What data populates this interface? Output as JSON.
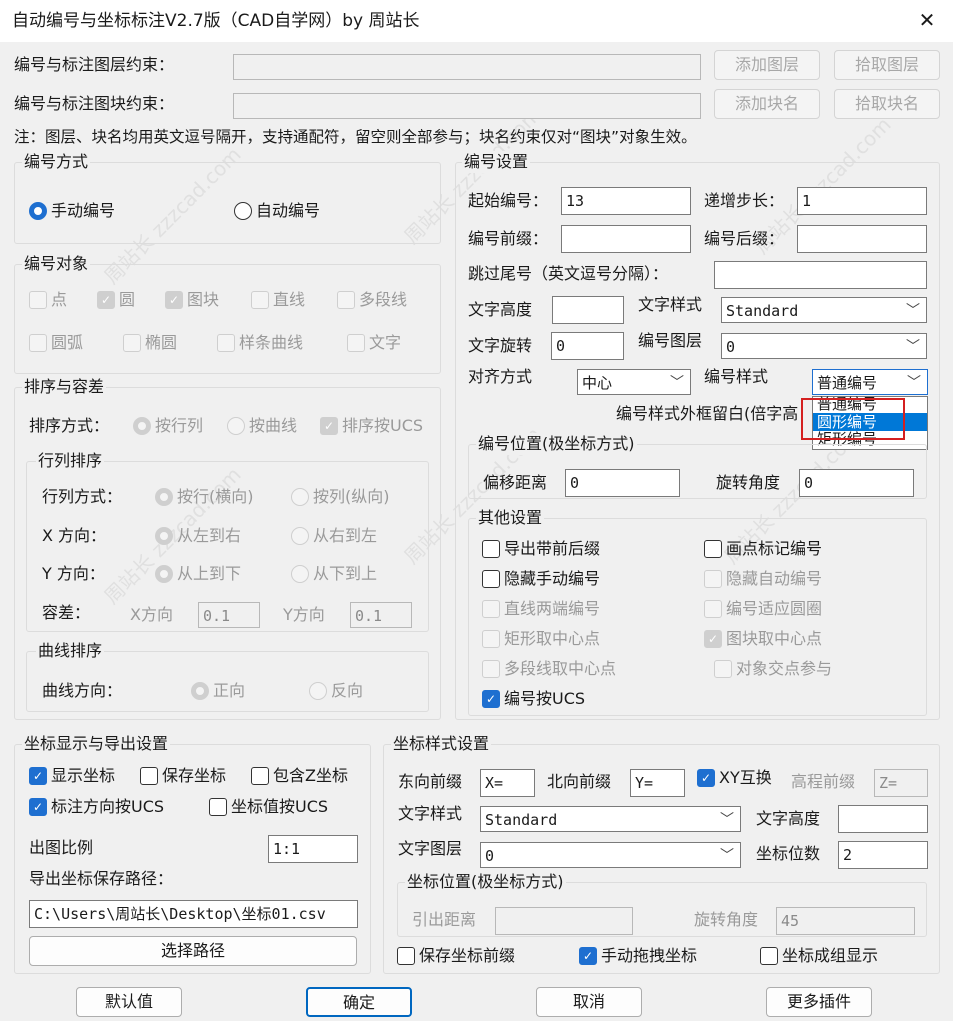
{
  "window": {
    "title": "自动编号与坐标标注V2.7版（CAD自学网）by 周站长",
    "close": "✕"
  },
  "top": {
    "layer_label": "编号与标注图层约束：",
    "block_label": "编号与标注图块约束：",
    "layer_value": "",
    "block_value": "",
    "add_layer": "添加图层",
    "pick_layer": "拾取图层",
    "add_block": "添加块名",
    "pick_block": "拾取块名",
    "note": "注：图层、块名均用英文逗号隔开，支持通配符，留空则全部参与；块名约束仅对“图块”对象生效。"
  },
  "numbering_mode": {
    "title": "编号方式",
    "manual": "手动编号",
    "auto": "自动编号",
    "selected": "手动编号"
  },
  "numbering_objects": {
    "title": "编号对象",
    "items": [
      {
        "label": "点",
        "checked": false
      },
      {
        "label": "圆",
        "checked": true
      },
      {
        "label": "图块",
        "checked": true
      },
      {
        "label": "直线",
        "checked": false
      },
      {
        "label": "多段线",
        "checked": false
      },
      {
        "label": "圆弧",
        "checked": false
      },
      {
        "label": "椭圆",
        "checked": false
      },
      {
        "label": "样条曲线",
        "checked": false
      },
      {
        "label": "文字",
        "checked": false
      }
    ]
  },
  "sort": {
    "title": "排序与容差",
    "mode_label": "排序方式：",
    "by_row": "按行列",
    "by_curve": "按曲线",
    "by_ucs": "排序按UCS",
    "row_col": {
      "title": "行列排序",
      "mode_label": "行列方式：",
      "row": "按行(横向)",
      "col": "按列(纵向)",
      "x_label": "X 方向：",
      "x_lr": "从左到右",
      "x_rl": "从右到左",
      "y_label": "Y 方向：",
      "y_tb": "从上到下",
      "y_bt": "从下到上",
      "tol_label": "容差：",
      "tol_x_label": "X方向",
      "tol_x": "0.1",
      "tol_y_label": "Y方向",
      "tol_y": "0.1"
    },
    "curve": {
      "title": "曲线排序",
      "dir_label": "曲线方向：",
      "forward": "正向",
      "reverse": "反向"
    }
  },
  "settings": {
    "title": "编号设置",
    "start_label": "起始编号：",
    "start": "13",
    "step_label": "递增步长：",
    "step": "1",
    "prefix_label": "编号前缀：",
    "prefix": "",
    "suffix_label": "编号后缀：",
    "suffix": "",
    "skip_label": "跳过尾号（英文逗号分隔）：",
    "skip": "",
    "text_height_label": "文字高度",
    "text_height": "",
    "text_style_label": "文字样式",
    "text_style": "Standard",
    "text_rot_label": "文字旋转",
    "text_rot": "0",
    "layer_label": "编号图层",
    "layer": "0",
    "align_label": "对齐方式",
    "align": "中心",
    "style_label": "编号样式",
    "style": "普通编号",
    "style_options": [
      "普通编号",
      "圆形编号",
      "矩形编号"
    ],
    "margin_label": "编号样式外框留白(倍字高",
    "polar": {
      "title": "编号位置(极坐标方式)",
      "offset_label": "偏移距离",
      "offset": "0",
      "rot_label": "旋转角度",
      "rot": "0"
    }
  },
  "other": {
    "title": "其他设置",
    "items": [
      {
        "label": "导出带前后缀",
        "checked": false,
        "disabled": false
      },
      {
        "label": "画点标记编号",
        "checked": false,
        "disabled": false
      },
      {
        "label": "隐藏手动编号",
        "checked": false,
        "disabled": false
      },
      {
        "label": "隐藏自动编号",
        "checked": false,
        "disabled": true
      },
      {
        "label": "直线两端编号",
        "checked": false,
        "disabled": true
      },
      {
        "label": "编号适应圆圈",
        "checked": false,
        "disabled": true
      },
      {
        "label": "矩形取中心点",
        "checked": false,
        "disabled": true
      },
      {
        "label": "图块取中心点",
        "checked": true,
        "disabled": true
      },
      {
        "label": "多段线取中心点",
        "checked": false,
        "disabled": true
      },
      {
        "label": "对象交点参与",
        "checked": false,
        "disabled": true
      },
      {
        "label": "编号按UCS",
        "checked": true,
        "disabled": false
      }
    ]
  },
  "coord_display": {
    "title": "坐标显示与导出设置",
    "show": "显示坐标",
    "save": "保存坐标",
    "include_z": "包含Z坐标",
    "dir_ucs": "标注方向按UCS",
    "val_ucs": "坐标值按UCS",
    "scale_label": "出图比例",
    "scale": "1:1",
    "path_label": "导出坐标保存路径：",
    "path": "C:\\Users\\周站长\\Desktop\\坐标01.csv",
    "choose": "选择路径"
  },
  "coord_style": {
    "title": "坐标样式设置",
    "east_label": "东向前缀",
    "east": "X=",
    "north_label": "北向前缀",
    "north": "Y=",
    "swap": "XY互换",
    "elev_label": "高程前缀",
    "elev": "Z=",
    "style_label": "文字样式",
    "style": "Standard",
    "height_label": "文字高度",
    "height": "",
    "layer_label": "文字图层",
    "layer": "0",
    "digits_label": "坐标位数",
    "digits": "2",
    "polar": {
      "title": "坐标位置(极坐标方式)",
      "lead_label": "引出距离",
      "lead": "",
      "rot_label": "旋转角度",
      "rot": "45"
    },
    "save_prefix": "保存坐标前缀",
    "manual_drag": "手动拖拽坐标",
    "grouped": "坐标成组显示"
  },
  "footer": {
    "default": "默认值",
    "ok": "确定",
    "cancel": "取消",
    "more": "更多插件"
  },
  "watermark": [
    "周站长 zzzcad.com",
    "周站长 zzzcad.com",
    "周站长 zzzcad.com",
    "周站长 zzzcad.com",
    "周站长 zzzcad.com",
    "周站长 zzzcad.com"
  ]
}
